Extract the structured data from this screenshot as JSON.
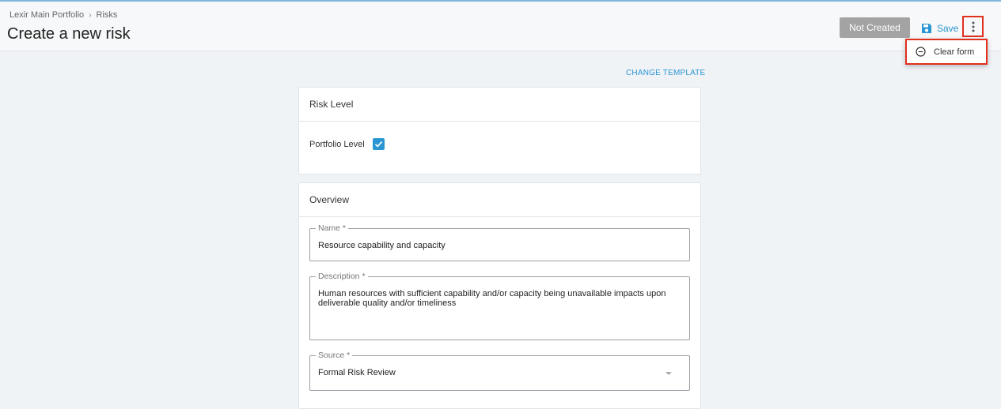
{
  "breadcrumb": {
    "parent": "Lexir Main Portfolio",
    "separator": "›",
    "current": "Risks"
  },
  "header": {
    "title": "Create a new risk",
    "status_label": "Not Created",
    "save_label": "Save"
  },
  "menu": {
    "items": [
      {
        "label": "Clear form",
        "icon": "minus-circle-icon"
      }
    ]
  },
  "change_template_label": "CHANGE TEMPLATE",
  "risk_level": {
    "title": "Risk Level",
    "portfolio_label": "Portfolio Level",
    "portfolio_checked": true
  },
  "overview": {
    "title": "Overview",
    "name": {
      "label": "Name *",
      "value": "Resource capability and capacity"
    },
    "description": {
      "label": "Description *",
      "value": "Human resources with sufficient capability and/or capacity being unavailable impacts upon deliverable quality and/or timeliness"
    },
    "source": {
      "label": "Source *",
      "value": "Formal Risk Review"
    }
  },
  "colors": {
    "accent": "#2a95d3",
    "highlight": "#e0301e",
    "status_bg": "#a3a3a3"
  }
}
